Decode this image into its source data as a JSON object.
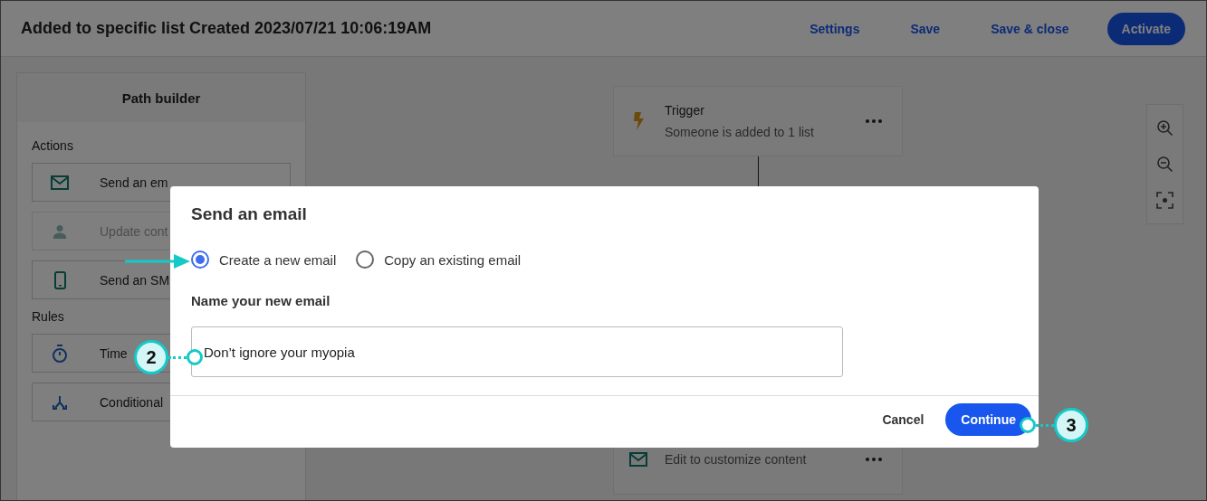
{
  "header": {
    "title": "Added to specific list Created 2023/07/21 10:06:19AM",
    "actions": [
      {
        "label": "Settings",
        "kind": "link"
      },
      {
        "label": "Save",
        "kind": "link"
      },
      {
        "label": "Save & close",
        "kind": "link"
      },
      {
        "label": "Activate",
        "kind": "primary"
      }
    ]
  },
  "sidebar": {
    "title": "Path builder",
    "sections": [
      {
        "heading": "Actions",
        "items": [
          {
            "label": "Send an em",
            "disabled": false
          },
          {
            "label": "Update cont",
            "disabled": true
          },
          {
            "label": "Send an SM",
            "disabled": false
          }
        ]
      },
      {
        "heading": "Rules",
        "items": [
          {
            "label": "Time",
            "disabled": false
          },
          {
            "label": "Conditional",
            "disabled": false
          }
        ]
      }
    ]
  },
  "canvas": {
    "cards": [
      {
        "title": "Trigger",
        "subtitle": "Someone is added to 1 list"
      },
      {
        "subtitle": "Edit to customize content"
      }
    ]
  },
  "dialog": {
    "title": "Send an email",
    "options": [
      {
        "label": "Create a new email",
        "selected": true
      },
      {
        "label": "Copy an existing email",
        "selected": false
      }
    ],
    "field_label": "Name your new email",
    "field_value": "Don’t ignore your myopia",
    "buttons": [
      {
        "label": "Cancel",
        "kind": "secondary"
      },
      {
        "label": "Continue",
        "kind": "primary"
      }
    ]
  },
  "callouts": [
    {
      "label": "2"
    },
    {
      "label": "3"
    }
  ]
}
